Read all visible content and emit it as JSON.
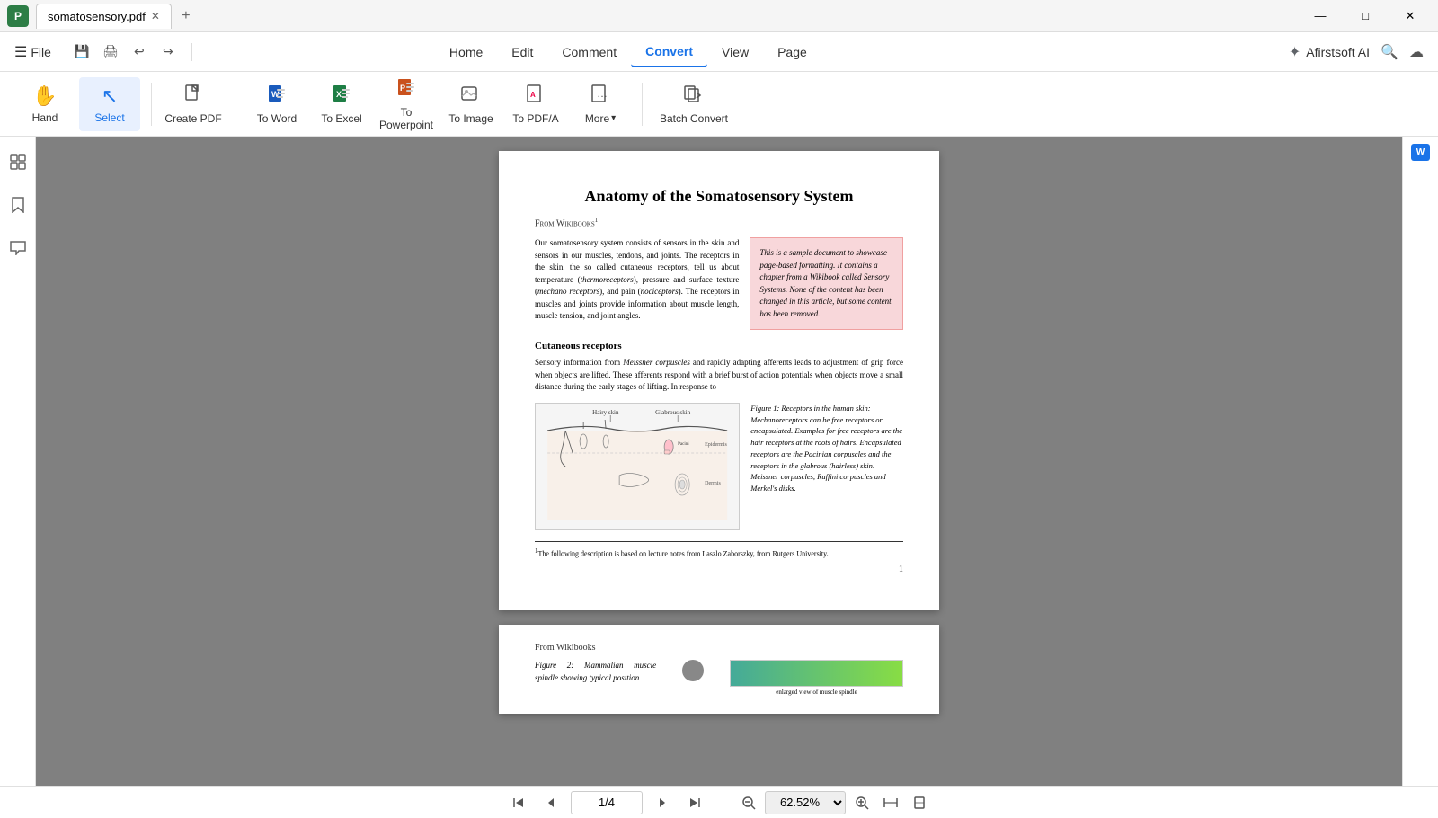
{
  "titlebar": {
    "tab_label": "somatosensory.pdf",
    "add_tab_symbol": "+",
    "controls": [
      "—",
      "□",
      "✕"
    ]
  },
  "menubar": {
    "hamburger": "☰",
    "file_label": "File",
    "actions": [
      "💾",
      "🖨",
      "↩",
      "↪"
    ],
    "nav_items": [
      "Home",
      "Edit",
      "Comment",
      "Convert",
      "View",
      "Page"
    ],
    "active_nav": "Convert",
    "ai_label": "Afirstsoft AI",
    "search_icon": "🔍",
    "cloud_icon": "☁"
  },
  "toolbar": {
    "tools": [
      {
        "id": "hand",
        "label": "Hand",
        "icon": "✋",
        "active": false
      },
      {
        "id": "select",
        "label": "Select",
        "icon": "↖",
        "active": true
      },
      {
        "id": "create-pdf",
        "label": "Create PDF",
        "icon": "📄",
        "active": false
      },
      {
        "id": "to-word",
        "label": "To Word",
        "icon": "📝",
        "active": false
      },
      {
        "id": "to-excel",
        "label": "To Excel",
        "icon": "📊",
        "active": false
      },
      {
        "id": "to-powerpoint",
        "label": "To Powerpoint",
        "icon": "📑",
        "active": false
      },
      {
        "id": "to-image",
        "label": "To Image",
        "icon": "🖼",
        "active": false
      },
      {
        "id": "to-pdfa",
        "label": "To PDF/A",
        "icon": "📄",
        "active": false
      }
    ],
    "more_label": "More",
    "batch_convert_label": "Batch Convert"
  },
  "document": {
    "page1": {
      "title": "Anatomy of the Somatosensory System",
      "from_wikibooks": "From Wikibooks",
      "superscript": "1",
      "body_paragraph": "Our somatosensory system consists of sensors in the skin and sensors in our muscles, tendons, and joints. The receptors in the skin, the so called cutaneous receptors, tell us about temperature (thermoreceptors), pressure and surface texture (mechano receptors), and pain (nociceptors). The receptors in muscles and joints provide information about muscle length, muscle tension, and joint angles.",
      "pink_box_text": "This is a sample document to showcase page-based formatting. It contains a chapter from a Wikibook called Sensory Systems. None of the content has been changed in this article, but some content has been removed.",
      "section_heading": "Cutaneous receptors",
      "section_body": "Sensory information from Meissner corpuscles and rapidly adapting afferents leads to adjustment of grip force when objects are lifted. These afferents respond with a brief burst of action potentials when objects move a small distance during the early stages of lifting. In response to",
      "figure_caption": "Figure 1: Receptors in the human skin: Mechanoreceptors can be free receptors or encapsulated. Examples for free receptors are the hair receptors at the roots of hairs. Encapsulated receptors are the Pacinian corpuscles and the receptors in the glabrous (hairless) skin: Meissner corpuscles, Ruffini corpuscles and Merkel's disks.",
      "footnote": "The following description is based on lecture notes from Laszlo Zaborszky, from Rutgers University.",
      "page_number": "1"
    },
    "page2": {
      "from_wikibooks": "From Wikibooks",
      "figure2_label": "Figure 2:  Mammalian muscle spindle showing typical position"
    }
  },
  "bottom_bar": {
    "first_page_icon": "⏮",
    "prev_page_icon": "◀",
    "next_page_icon": "▶",
    "last_page_icon": "⏭",
    "page_display": "1/4",
    "zoom_out_icon": "−",
    "zoom_in_icon": "+",
    "zoom_value": "62.52%",
    "fit_width_icon": "↔",
    "fit_page_icon": "⛶"
  },
  "left_sidebar": {
    "icons": [
      "☰",
      "🔖",
      "💬"
    ]
  },
  "right_sidebar": {
    "word_badge": "W"
  }
}
